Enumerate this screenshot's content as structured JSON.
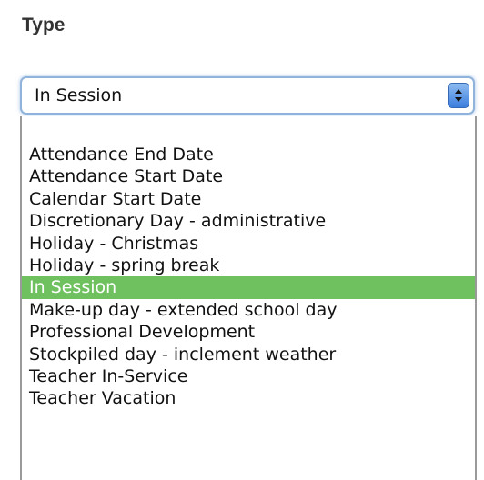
{
  "type_field": {
    "label": "Type",
    "selected_value": "In Session",
    "options": [
      "Attendance End Date",
      "Attendance Start Date",
      "Calendar Start Date",
      "Discretionary Day - administrative",
      "Holiday - Christmas",
      "Holiday - spring break",
      "In Session",
      "Make-up day - extended school day",
      "Professional Development",
      "Stockpiled day - inclement weather",
      "Teacher In-Service",
      "Teacher Vacation"
    ],
    "highlighted_index": 6
  },
  "colors": {
    "highlight": "#6fc160",
    "focus_ring": "#8fb3db",
    "stepper": "#4a8ae6"
  },
  "icons": {
    "select_arrows": "up-down-chevron-icon"
  }
}
